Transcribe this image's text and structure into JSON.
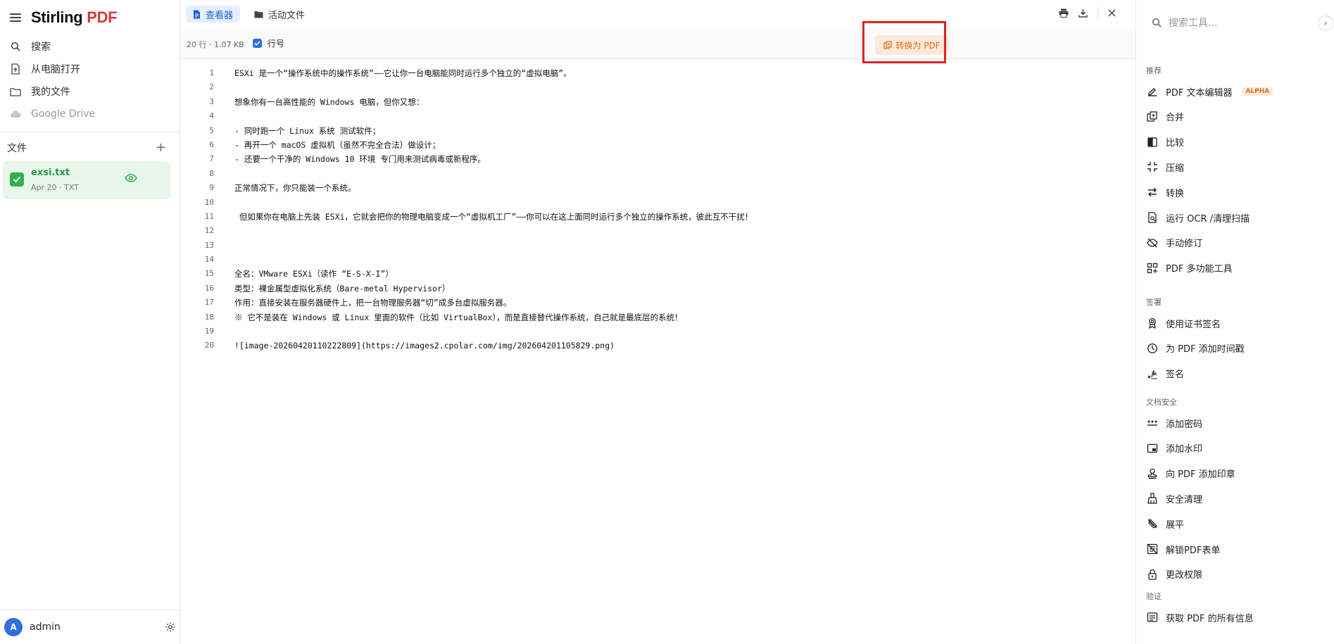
{
  "brand": {
    "name": "Stirling",
    "pdf": "PDF"
  },
  "nav": [
    {
      "label": "搜索",
      "icon": "search-icon"
    },
    {
      "label": "从电脑打开",
      "icon": "file-upload-icon"
    },
    {
      "label": "我的文件",
      "icon": "folder-icon"
    },
    {
      "label": "Google Drive",
      "icon": "cloud-icon",
      "disabled": true
    }
  ],
  "files": {
    "header": "文件",
    "add": "+",
    "items": [
      {
        "name": "exsi.txt",
        "meta": "Apr 20 · TXT"
      }
    ]
  },
  "user": {
    "initial": "A",
    "name": "admin"
  },
  "tabs": [
    {
      "label": "查看器",
      "icon": "viewer-icon",
      "active": true
    },
    {
      "label": "活动文件",
      "icon": "folder-icon",
      "active": false
    }
  ],
  "toolbar": {
    "stats": "20 行 · 1.07 KB",
    "line_numbers_label": "行号",
    "line_numbers_checked": true,
    "convert_label": "转换为 PDF"
  },
  "lines": [
    "ESXi 是一个“操作系统中的操作系统”——它让你一台电脑能同时运行多个独立的“虚拟电脑”。",
    "",
    "想象你有一台高性能的 Windows 电脑，但你又想：",
    "",
    "- 同时跑一个 Linux 系统 测试软件；",
    "- 再开一个 macOS 虚拟机（虽然不完全合法）做设计；",
    "- 还要一个干净的 Windows 10 环境 专门用来测试病毒或新程序。",
    "",
    "正常情况下，你只能装一个系统。",
    "",
    " 但如果你在电脑上先装 ESXi，它就会把你的物理电脑变成一个“虚拟机工厂”——你可以在这上面同时运行多个独立的操作系统，彼此互不干扰！",
    "",
    "",
    "",
    "全名：VMware ESXi（读作 “E-S-X-I”）",
    "类型：裸金属型虚拟化系统（Bare-metal Hypervisor）",
    "作用：直接安装在服务器硬件上，把一台物理服务器“切”成多台虚拟服务器。",
    "※ 它不是装在 Windows 或 Linux 里面的软件（比如 VirtualBox），而是直接替代操作系统，自己就是最底层的系统！",
    "",
    "![image-20260420110222809](https://images2.cpolar.com/img/20260420110582​9.png)"
  ],
  "right": {
    "search_placeholder": "搜索工具...",
    "collapse": "›",
    "sections": [
      {
        "title": "推荐",
        "items": [
          {
            "label": "PDF 文本编辑器",
            "badge": "ALPHA",
            "icon": "edit-icon"
          },
          {
            "label": "合并",
            "icon": "merge-icon"
          },
          {
            "label": "比较",
            "icon": "compare-icon"
          },
          {
            "label": "压缩",
            "icon": "compress-icon"
          },
          {
            "label": "转换",
            "icon": "convert-icon"
          },
          {
            "label": "运行 OCR /清理扫描",
            "icon": "ocr-icon"
          },
          {
            "label": "手动修订",
            "icon": "redact-icon"
          },
          {
            "label": "PDF 多功能工具",
            "icon": "multitool-icon"
          }
        ]
      },
      {
        "title": "签署",
        "items": [
          {
            "label": "使用证书签名",
            "icon": "certificate-icon"
          },
          {
            "label": "为 PDF 添加时间戳",
            "icon": "clock-icon"
          },
          {
            "label": "签名",
            "icon": "signature-icon"
          }
        ]
      },
      {
        "title": "文档安全",
        "items": [
          {
            "label": "添加密码",
            "icon": "password-icon"
          },
          {
            "label": "添加水印",
            "icon": "watermark-icon"
          },
          {
            "label": "向 PDF 添加印章",
            "icon": "stamp-icon"
          },
          {
            "label": "安全清理",
            "icon": "sanitize-icon"
          },
          {
            "label": "展平",
            "icon": "flatten-icon"
          },
          {
            "label": "解锁PDF表单",
            "icon": "unlock-form-icon"
          },
          {
            "label": "更改权限",
            "icon": "lock-icon"
          }
        ]
      },
      {
        "title": "验证",
        "items": [
          {
            "label": "获取 PDF 的所有信息",
            "icon": "info-icon"
          }
        ]
      }
    ]
  },
  "colors": {
    "accent": "#2f6fde",
    "brand_red": "#d33a3a",
    "file_green": "#2bb24c",
    "convert_orange": "#e0701c",
    "highlight_red": "#e02323"
  }
}
